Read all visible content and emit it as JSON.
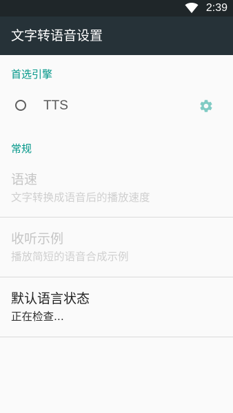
{
  "status_bar": {
    "time": "2:39",
    "wifi_icon": "wifi-icon"
  },
  "app_bar": {
    "title": "文字转语音设置"
  },
  "preferred_engine": {
    "header": "首选引擎",
    "engines": [
      {
        "label": "TTS",
        "selected": false,
        "settings_icon": "gear-icon"
      }
    ]
  },
  "general": {
    "header": "常规",
    "items": [
      {
        "title": "语速",
        "summary": "文字转换成语音后的播放速度",
        "enabled": false
      },
      {
        "title": "收听示例",
        "summary": "播放简短的语音合成示例",
        "enabled": false
      },
      {
        "title": "默认语言状态",
        "summary": "正在检查...",
        "enabled": true
      }
    ]
  },
  "colors": {
    "accent": "#009688",
    "app_bar": "#263238",
    "status_bar": "#1f2629",
    "gear": "#80cbc4"
  }
}
